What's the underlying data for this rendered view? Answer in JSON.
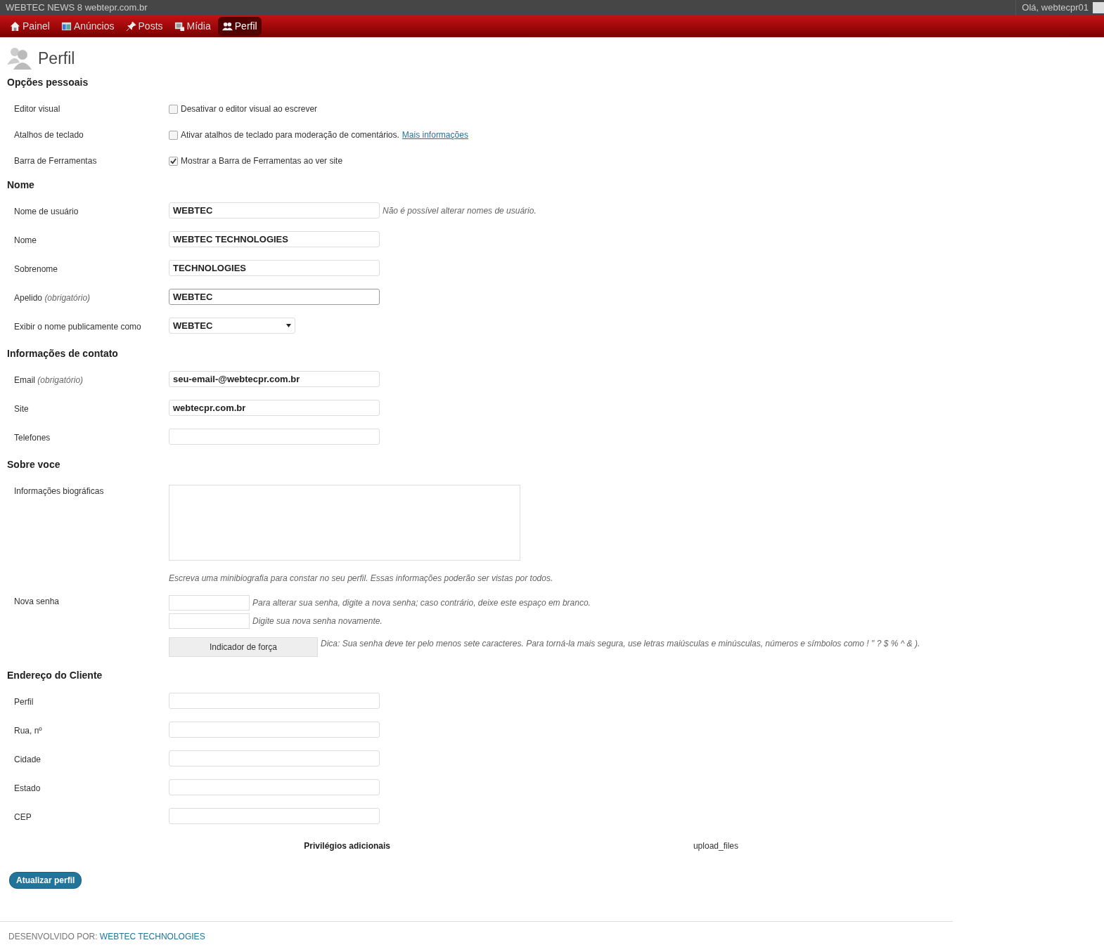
{
  "topbar": {
    "site_title": "WEBTEC NEWS 8 webtepr.com.br",
    "greeting": "Olá, webtecpr01"
  },
  "menu": [
    {
      "kind": "home",
      "label": "Painel",
      "selected": false
    },
    {
      "kind": "ads",
      "label": "Anúncios",
      "selected": false
    },
    {
      "kind": "pin",
      "label": "Posts",
      "selected": false
    },
    {
      "kind": "media",
      "label": "Mídia",
      "selected": false
    },
    {
      "kind": "users",
      "label": "Perfil",
      "selected": true
    }
  ],
  "page_title": "Perfil",
  "sections": [
    {
      "heading": "Opções pessoais",
      "rows": [
        {
          "kind": "checkbox",
          "label": "Editor visual",
          "text": "Desativar o editor visual ao escrever",
          "checked": false
        },
        {
          "kind": "checkbox",
          "label": "Atalhos de teclado",
          "text": "Ativar atalhos de teclado para moderação de comentários.",
          "link": "Mais informações",
          "checked": false
        },
        {
          "kind": "checkbox",
          "label": "Barra de Ferramentas",
          "text": "Mostrar a Barra de Ferramentas ao ver site",
          "checked": true
        }
      ]
    },
    {
      "heading": "Nome",
      "rows": [
        {
          "kind": "input",
          "label": "Nome de usuário",
          "value": "WEBTEC",
          "note": "Não é possível alterar nomes de usuário.",
          "focused": false
        },
        {
          "kind": "input",
          "label": "Nome",
          "value": "WEBTEC TECHNOLOGIES",
          "focused": false
        },
        {
          "kind": "input",
          "label": "Sobrenome",
          "value": "TECHNOLOGIES",
          "focused": false
        },
        {
          "kind": "input",
          "label": "Apelido",
          "label_note": "(obrigatório)",
          "value": "WEBTEC",
          "focused": true
        },
        {
          "kind": "select",
          "label": "Exibir o nome publicamente como",
          "value": "WEBTEC"
        }
      ]
    },
    {
      "heading": "Informações de contato",
      "rows": [
        {
          "kind": "input",
          "label": "Email",
          "label_note": "(obrigatório)",
          "value": "seu-email-@webtecpr.com.br",
          "focused": false
        },
        {
          "kind": "input",
          "label": "Site",
          "value": "webtecpr.com.br",
          "focused": false
        },
        {
          "kind": "input",
          "label": "Telefones",
          "focused": false
        }
      ]
    },
    {
      "heading": "Sobre voce",
      "rows": [
        {
          "kind": "textarea",
          "label": "Informações biográficas",
          "note": "Escreva uma minibiografia para constar no seu perfil. Essas informações poderão ser vistas por todos."
        },
        {
          "kind": "password",
          "label": "Nova senha",
          "note": "Para alterar sua senha, digite a nova senha; caso contrário, deixe este espaço em branco.",
          "repeat_note": "Digite sua nova senha novamente.",
          "strength": "Indicador de força",
          "hint": "Dica: Sua senha deve ter pelo menos sete caracteres. Para torná-la mais segura, use letras maiúsculas e minúsculas, números e símbolos como ! \" ? $ % ^ & )."
        }
      ]
    },
    {
      "heading": "Endereço do Cliente",
      "rows": [
        {
          "kind": "input",
          "label": "Perfil",
          "focused": false
        },
        {
          "kind": "input",
          "label": "Rua, nº",
          "focused": false
        },
        {
          "kind": "input",
          "label": "Cidade",
          "focused": false
        },
        {
          "kind": "input",
          "label": "Estado",
          "focused": false
        },
        {
          "kind": "input",
          "label": "CEP",
          "focused": false
        }
      ]
    }
  ],
  "privileges": {
    "label": "Privilégios adicionais",
    "value": "upload_files"
  },
  "submit": "Atualizar perfil",
  "footer": {
    "prefix": "DESENVOLVIDO POR:",
    "link": "WEBTEC TECHNOLOGIES"
  }
}
